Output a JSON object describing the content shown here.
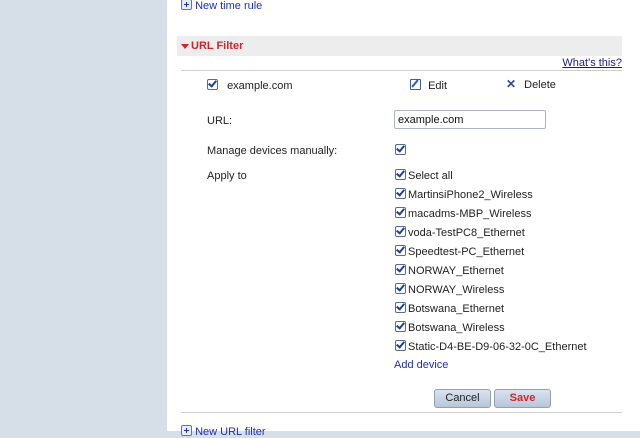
{
  "top_link": {
    "label": "New time rule"
  },
  "section": {
    "title": "URL Filter",
    "help": "What's this?"
  },
  "rule": {
    "name": "example.com",
    "edit_label": "Edit",
    "delete_label": "Delete"
  },
  "form": {
    "url_label": "URL:",
    "url_value": "example.com",
    "manage_label": "Manage devices manually:",
    "apply_label": "Apply to"
  },
  "devices": [
    "Select all",
    "MartinsiPhone2_Wireless",
    "macadms-MBP_Wireless",
    "voda-TestPC8_Ethernet",
    "Speedtest-PC_Ethernet",
    "NORWAY_Ethernet",
    "NORWAY_Wireless",
    "Botswana_Ethernet",
    "Botswana_Wireless",
    "Static-D4-BE-D9-06-32-0C_Ethernet"
  ],
  "add_device_label": "Add device",
  "buttons": {
    "cancel": "Cancel",
    "save": "Save"
  },
  "bottom_link": {
    "label": "New URL filter"
  },
  "colors": {
    "accent_red": "#d6232b",
    "link_blue": "#1a2ec8",
    "sidebar_bg": "#d6dee8"
  }
}
